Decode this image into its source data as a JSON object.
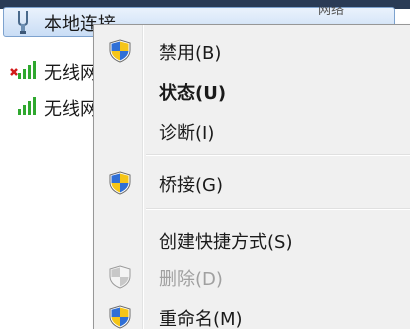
{
  "connections": [
    {
      "label": "本地连接",
      "selected": true,
      "icon": "network-adapter-icon",
      "status": "网络"
    },
    {
      "label": "无线网",
      "selected": false,
      "icon": "wifi-signal-disabled-icon"
    },
    {
      "label": "无线网",
      "selected": false,
      "icon": "wifi-signal-icon"
    }
  ],
  "menu": {
    "items": [
      {
        "label": "禁用(B)",
        "icon": "uac-shield-icon",
        "bold": false,
        "disabled": false
      },
      {
        "label": "状态(U)",
        "icon": "",
        "bold": true,
        "disabled": false
      },
      {
        "label": "诊断(I)",
        "icon": "",
        "bold": false,
        "disabled": false
      },
      {
        "label": "桥接(G)",
        "icon": "uac-shield-icon",
        "bold": false,
        "disabled": false
      },
      {
        "label": "创建快捷方式(S)",
        "icon": "",
        "bold": false,
        "disabled": false
      },
      {
        "label": "删除(D)",
        "icon": "uac-shield-disabled-icon",
        "bold": false,
        "disabled": true
      },
      {
        "label": "重命名(M)",
        "icon": "uac-shield-icon",
        "bold": false,
        "disabled": false
      }
    ]
  },
  "colors": {
    "menu_background": "#f0f0f0",
    "selection_border": "#7da2ce",
    "disabled_text": "#a0a0a0",
    "signal_green": "#2fa82f"
  }
}
